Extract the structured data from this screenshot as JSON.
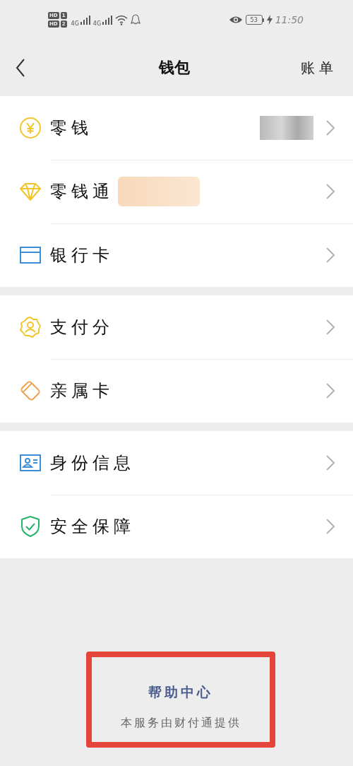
{
  "status_bar": {
    "sims": [
      {
        "hd": "HD",
        "slot": "1"
      },
      {
        "hd": "HD",
        "slot": "2"
      }
    ],
    "networks": [
      "4G",
      "4G"
    ],
    "battery": "53",
    "charging": true,
    "time": "11:50"
  },
  "header": {
    "title": "钱包",
    "action": "账单"
  },
  "groups": [
    {
      "items": [
        {
          "label": "零钱",
          "kind": "value"
        },
        {
          "label": "零钱通",
          "kind": "badge"
        },
        {
          "label": "银行卡",
          "kind": "plain"
        }
      ]
    },
    {
      "items": [
        {
          "label": "支付分",
          "kind": "plain"
        },
        {
          "label": "亲属卡",
          "kind": "plain"
        }
      ]
    },
    {
      "items": [
        {
          "label": "身份信息",
          "kind": "plain"
        },
        {
          "label": "安全保障",
          "kind": "plain"
        }
      ]
    }
  ],
  "footer": {
    "link": "帮助中心",
    "note": "本服务由财付通提供",
    "highlighted": true
  }
}
